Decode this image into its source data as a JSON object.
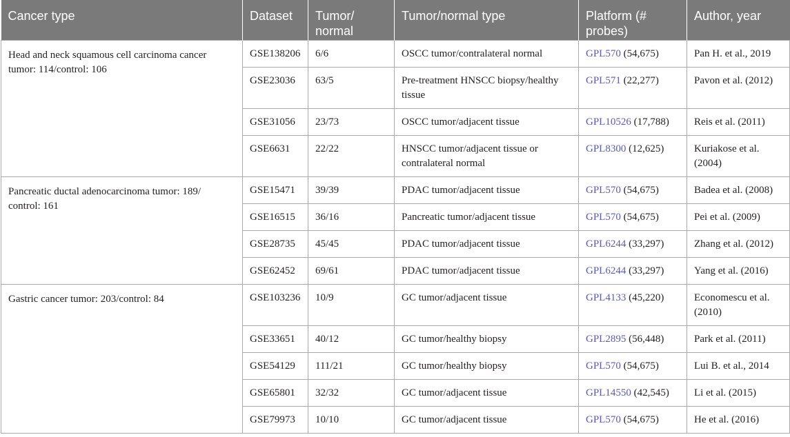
{
  "headers": {
    "cancer_type": "Cancer type",
    "dataset": "Dataset",
    "tumor_normal_line1": "Tumor/",
    "tumor_normal_line2": "normal",
    "tumor_normal_type": "Tumor/normal type",
    "platform_line1": "Platform (#",
    "platform_line2": "probes)",
    "author_year": "Author, year"
  },
  "groups": [
    {
      "cancer_line1": "Head and neck squamous cell carcinoma cancer",
      "cancer_line2": "tumor: 114/control: 106",
      "rows": [
        {
          "dataset": "GSE138206",
          "tn": "6/6",
          "type": "OSCC tumor/contralateral normal",
          "gpl": "GPL570",
          "probes": " (54,675)",
          "author": "Pan H. et al., 2019"
        },
        {
          "dataset": "GSE23036",
          "tn": "63/5",
          "type": "Pre-treatment HNSCC biopsy/healthy tissue",
          "gpl": "GPL571",
          "probes": " (22,277)",
          "author": "Pavon et al. (2012)"
        },
        {
          "dataset": "GSE31056",
          "tn": "23/73",
          "type": "OSCC tumor/adjacent tissue",
          "gpl": "GPL10526",
          "probes": " (17,788)",
          "author": "Reis et al. (2011)"
        },
        {
          "dataset": "GSE6631",
          "tn": "22/22",
          "type": "HNSCC tumor/adjacent tissue or contralateral normal",
          "gpl": "GPL8300",
          "probes": " (12,625)",
          "author": "Kuriakose et al. (2004)"
        }
      ]
    },
    {
      "cancer_line1": "Pancreatic ductal adenocarcinoma tumor: 189/",
      "cancer_line2": "control: 161",
      "rows": [
        {
          "dataset": "GSE15471",
          "tn": "39/39",
          "type": "PDAC tumor/adjacent tissue",
          "gpl": "GPL570",
          "probes": " (54,675)",
          "author": "Badea et al. (2008)"
        },
        {
          "dataset": "GSE16515",
          "tn": "36/16",
          "type": "Pancreatic tumor/adjacent tissue",
          "gpl": "GPL570",
          "probes": " (54,675)",
          "author": "Pei et al. (2009)"
        },
        {
          "dataset": "GSE28735",
          "tn": "45/45",
          "type": "PDAC tumor/adjacent tissue",
          "gpl": "GPL6244",
          "probes": " (33,297)",
          "author": "Zhang et al. (2012)"
        },
        {
          "dataset": "GSE62452",
          "tn": "69/61",
          "type": "PDAC tumor/adjacent tissue",
          "gpl": "GPL6244",
          "probes": " (33,297)",
          "author": "Yang et al. (2016)"
        }
      ]
    },
    {
      "cancer_line1": "Gastric cancer tumor: 203/control: 84",
      "cancer_line2": "",
      "rows": [
        {
          "dataset": "GSE103236",
          "tn": "10/9",
          "type": "GC tumor/adjacent tissue",
          "gpl": "GPL4133",
          "probes": " (45,220)",
          "author": "Economescu et al. (2010)"
        },
        {
          "dataset": "GSE33651",
          "tn": "40/12",
          "type": "GC tumor/healthy biopsy",
          "gpl": "GPL2895",
          "probes": " (56,448)",
          "author": "Park et al. (2011)"
        },
        {
          "dataset": "GSE54129",
          "tn": "111/21",
          "type": "GC tumor/healthy biopsy",
          "gpl": "GPL570",
          "probes": " (54,675)",
          "author": "Lui B. et al., 2014"
        },
        {
          "dataset": "GSE65801",
          "tn": "32/32",
          "type": "GC tumor/adjacent tissue",
          "gpl": "GPL14550",
          "probes": " (42,545)",
          "author": "Li et al. (2015)"
        },
        {
          "dataset": "GSE79973",
          "tn": "10/10",
          "type": "GC tumor/adjacent tissue",
          "gpl": "GPL570",
          "probes": " (54,675)",
          "author": "He et al. (2016)"
        }
      ]
    }
  ]
}
